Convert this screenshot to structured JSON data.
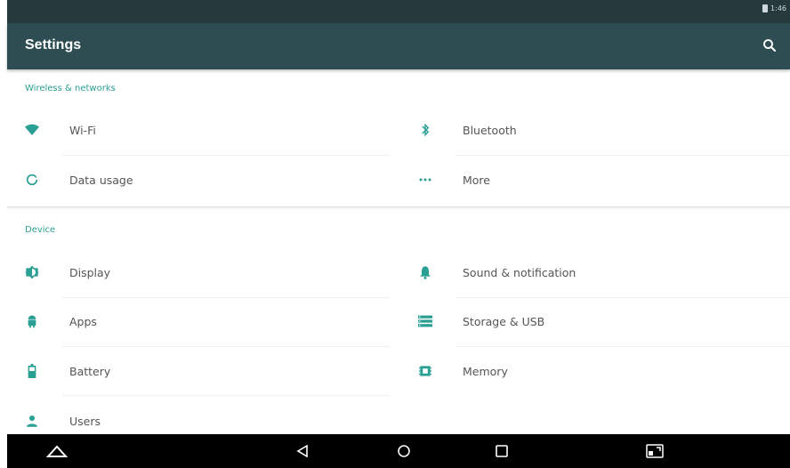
{
  "status": {
    "time": "1:46"
  },
  "appbar": {
    "title": "Settings",
    "search_icon": "search-icon"
  },
  "sections": [
    {
      "title": "Wireless & networks",
      "items": [
        {
          "label": "Wi-Fi",
          "icon": "wifi-icon"
        },
        {
          "label": "Bluetooth",
          "icon": "bluetooth-icon"
        },
        {
          "label": "Data usage",
          "icon": "data-usage-icon"
        },
        {
          "label": "More",
          "icon": "more-icon"
        }
      ]
    },
    {
      "title": "Device",
      "items": [
        {
          "label": "Display",
          "icon": "display-icon"
        },
        {
          "label": "Sound & notification",
          "icon": "bell-icon"
        },
        {
          "label": "Apps",
          "icon": "android-icon"
        },
        {
          "label": "Storage & USB",
          "icon": "storage-icon"
        },
        {
          "label": "Battery",
          "icon": "battery-icon"
        },
        {
          "label": "Memory",
          "icon": "memory-icon"
        },
        {
          "label": "Users",
          "icon": "user-icon"
        }
      ]
    }
  ],
  "colors": {
    "accent": "#2a9f93",
    "appbar": "#2d4d52",
    "statusbar": "#263a3e"
  },
  "navbar": {
    "icons": [
      "up-icon",
      "back-icon",
      "home-icon",
      "recents-icon",
      "screenshot-icon"
    ]
  }
}
